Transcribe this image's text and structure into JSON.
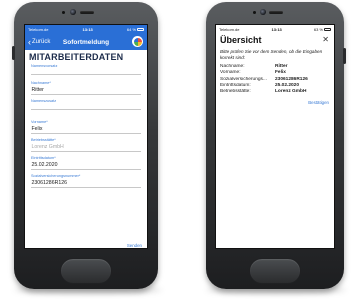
{
  "left_phone": {
    "status_bar": {
      "carrier": "Telekom.de",
      "time": "13:13",
      "battery": "64 %"
    },
    "nav": {
      "back_label": "Zurück",
      "title": "Sofortmeldung"
    },
    "section_title": "MITARBEITERDATEN",
    "fields": [
      {
        "label": "Namensvorsatz",
        "value": ""
      },
      {
        "label": "Nachname*",
        "value": "Ritter"
      },
      {
        "label": "Namenszusatz",
        "value": ""
      },
      {
        "label": "Vorname*",
        "value": "Felix"
      },
      {
        "label": "Betriebsstätte*",
        "value": "Lorenz GmbH"
      },
      {
        "label": "Eintrittsdatum*",
        "value": "25.02.2020"
      },
      {
        "label": "Sozialversicherungsnummer*",
        "value": "23061286R126"
      }
    ],
    "send_label": "Senden"
  },
  "right_phone": {
    "status_bar": {
      "carrier": "Telekom.de",
      "time": "13:13",
      "battery": "63 %"
    },
    "title": "Übersicht",
    "close_icon": "close-icon",
    "note": "Bitte prüfen Sie vor dem Senden, ob die Eingaben korrekt sind:",
    "rows": [
      {
        "key": "Nachname:",
        "value": "Ritter"
      },
      {
        "key": "Vorname:",
        "value": "Felix"
      },
      {
        "key": "Sozialversicherungs...",
        "value": "23061286R126"
      },
      {
        "key": "Eintrittsdatum:",
        "value": "25.02.2020"
      },
      {
        "key": "Betriebsstätte:",
        "value": "Lorenz GmbH"
      }
    ],
    "confirm_label": "Bestätigen"
  },
  "colors": {
    "accent_blue": "#2a6fd6",
    "link_blue": "#3a7bd5",
    "heading_navy": "#1c2b4a",
    "phone_body": "#36383a"
  }
}
